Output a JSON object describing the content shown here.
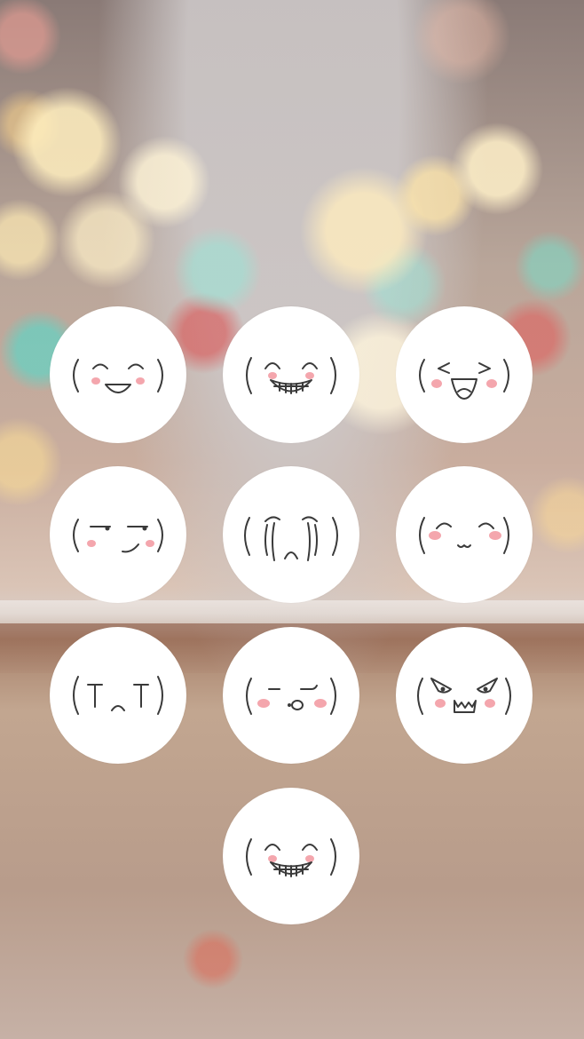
{
  "screen": "lock-screen-pattern",
  "colors": {
    "key_fill": "#ffffff",
    "line": "#3a3a3a",
    "blush": "#f4a6ad",
    "mouth_fill": "#ef7f90"
  },
  "keys": [
    {
      "name": "smiling-open-mouth-face-icon",
      "row": 1,
      "col": 1
    },
    {
      "name": "grinning-teeth-face-icon",
      "row": 1,
      "col": 2
    },
    {
      "name": "laughing-squint-face-icon",
      "row": 1,
      "col": 3
    },
    {
      "name": "smirking-face-icon",
      "row": 2,
      "col": 1
    },
    {
      "name": "crying-face-icon",
      "row": 2,
      "col": 2
    },
    {
      "name": "content-cat-mouth-face-icon",
      "row": 2,
      "col": 3
    },
    {
      "name": "sad-tears-face-icon",
      "row": 3,
      "col": 1
    },
    {
      "name": "unimpressed-pout-face-icon",
      "row": 3,
      "col": 2
    },
    {
      "name": "angry-face-icon",
      "row": 3,
      "col": 3
    },
    {
      "name": "grinning-teeth-face-icon",
      "row": 4,
      "col": 2
    }
  ]
}
